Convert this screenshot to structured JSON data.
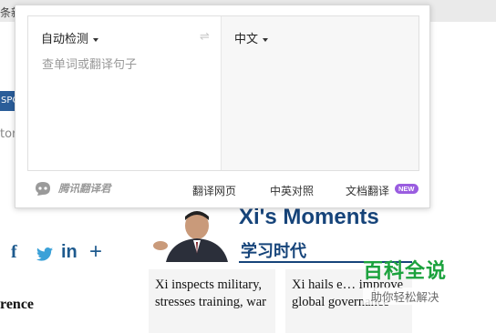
{
  "background": {
    "topbar_text": "条新",
    "blue_tab_text": "SPO",
    "side_text": "tory",
    "social_icons": [
      "facebook-icon",
      "twitter-icon",
      "linkedin-icon",
      "plus-icon"
    ],
    "social_glyphs": {
      "facebook": "f",
      "twitter": "t",
      "linkedin": "in",
      "plus": "+"
    },
    "conference_heading": "rence",
    "banner": {
      "title_en": "Xi's Moments",
      "title_cn": "学习时代"
    },
    "cards": [
      {
        "text": "Xi inspects military, stresses training, war"
      },
      {
        "text": "Xi hails e… improve global governance"
      }
    ]
  },
  "watermark": {
    "title": "百科全说",
    "subtitle": "助你轻松解决"
  },
  "translator": {
    "source_lang": "自动检测",
    "target_lang": "中文",
    "swap_glyph": "⇌",
    "input_placeholder": "查单词或翻译句子",
    "input_value": "",
    "brand_name": "腾讯翻译君",
    "links": {
      "web": "翻译网页",
      "bilingual": "中英对照",
      "document": "文档翻译"
    },
    "new_badge": "NEW",
    "colors": {
      "badge": "#9a5de0",
      "target_pane_bg": "#f7f7f7"
    }
  }
}
